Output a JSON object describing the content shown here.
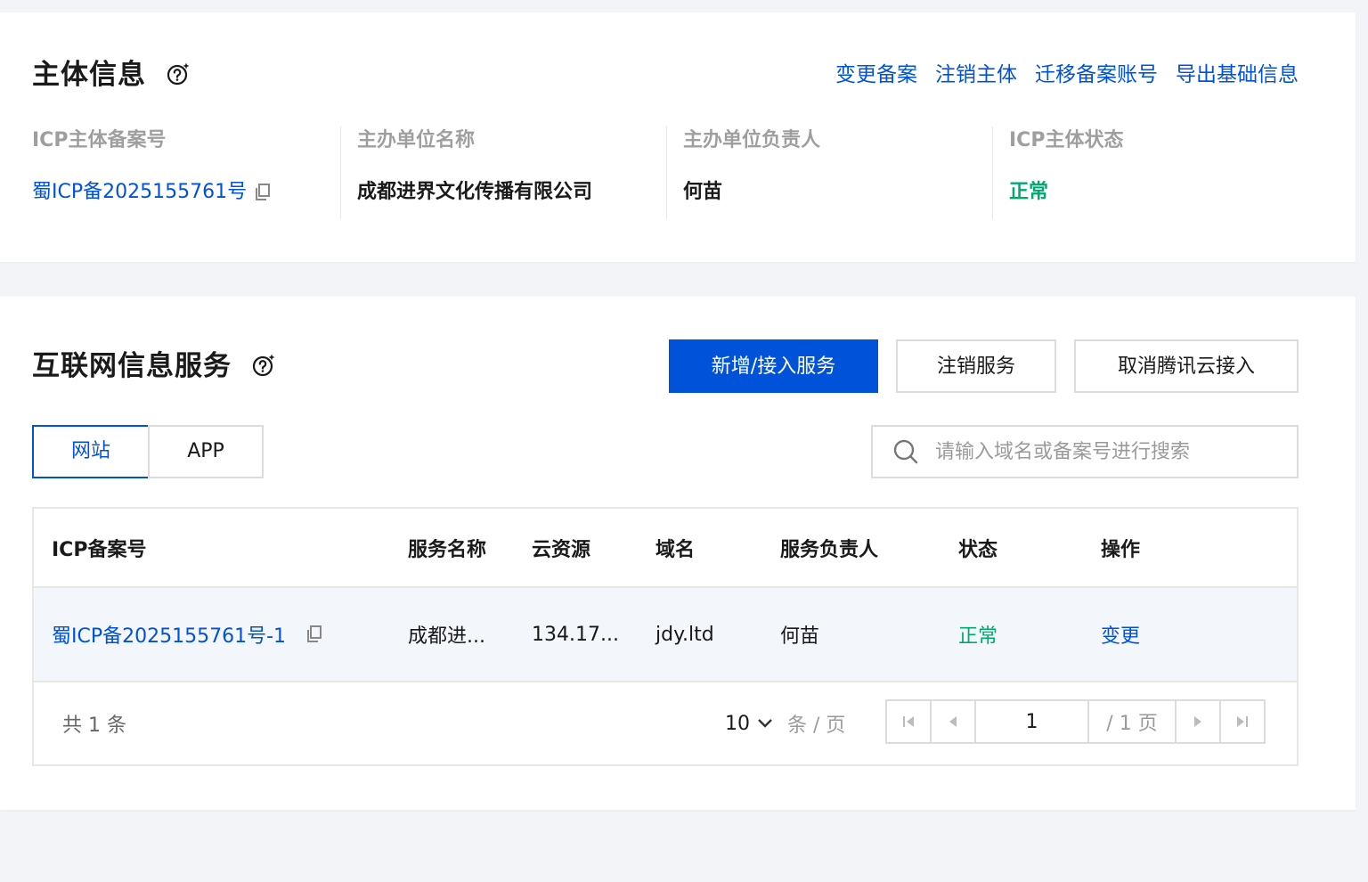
{
  "entity": {
    "title": "主体信息",
    "actions": [
      "变更备案",
      "注销主体",
      "迁移备案账号",
      "导出基础信息"
    ],
    "fields": [
      {
        "label": "ICP主体备案号",
        "value": "蜀ICP备2025155761号"
      },
      {
        "label": "主办单位名称",
        "value": "成都进界文化传播有限公司"
      },
      {
        "label": "主办单位负责人",
        "value": "何苗"
      },
      {
        "label": "ICP主体状态",
        "value": "正常"
      }
    ]
  },
  "service": {
    "title": "互联网信息服务",
    "buttons": {
      "add": "新增/接入服务",
      "cancel_service": "注销服务",
      "cancel_access": "取消腾讯云接入"
    },
    "tabs": [
      "网站",
      "APP"
    ],
    "search": {
      "placeholder": "请输入域名或备案号进行搜索"
    },
    "table": {
      "columns": [
        "ICP备案号",
        "服务名称",
        "云资源",
        "域名",
        "服务负责人",
        "状态",
        "操作"
      ],
      "rows": [
        {
          "icp": "蜀ICP备2025155761号-1",
          "name": "成都进...",
          "resource": "134.17...",
          "domain": "jdy.ltd",
          "owner": "何苗",
          "status": "正常",
          "action": "变更"
        }
      ]
    },
    "pagination": {
      "total": "共 1 条",
      "page_size": "10",
      "per_page_label": "条 / 页",
      "current_page": "1",
      "total_pages": "/ 1 页"
    }
  },
  "colors": {
    "primary": "#0052d9",
    "success": "#00a870",
    "border": "#dcdcdc",
    "background": "#f3f4f7"
  }
}
